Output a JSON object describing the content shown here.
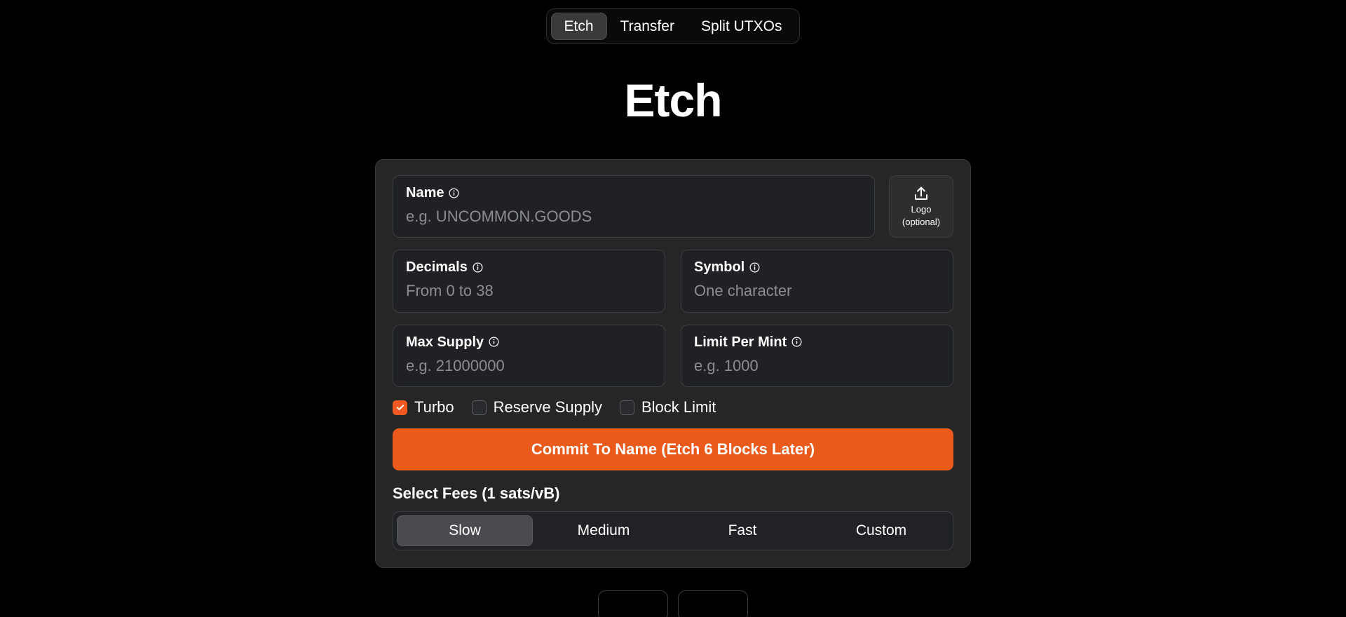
{
  "colors": {
    "page_background": "#000000",
    "card_background": "#262626",
    "field_background": "#202124",
    "accent_orange": "#ea5a1b",
    "checkbox_checked": "#f05a22",
    "selected_pill": "#4a4b4f",
    "text_primary": "#ffffff",
    "text_placeholder": "#8b8d91"
  },
  "tabs": [
    {
      "label": "Etch",
      "selected": true
    },
    {
      "label": "Transfer",
      "selected": false
    },
    {
      "label": "Split UTXOs",
      "selected": false
    }
  ],
  "page": {
    "title": "Etch"
  },
  "form": {
    "name": {
      "label": "Name",
      "placeholder": "e.g. UNCOMMON.GOODS",
      "value": "",
      "info_icon": "info-circle-icon"
    },
    "logo": {
      "line1": "Logo",
      "line2": "(optional)",
      "icon": "upload-icon"
    },
    "decimals": {
      "label": "Decimals",
      "placeholder": "From 0 to 38",
      "value": "",
      "info_icon": "info-circle-icon"
    },
    "symbol": {
      "label": "Symbol",
      "placeholder": "One character",
      "value": "",
      "info_icon": "info-circle-icon"
    },
    "max_supply": {
      "label": "Max Supply",
      "placeholder": "e.g. 21000000",
      "value": "",
      "info_icon": "info-circle-icon"
    },
    "limit_per_mint": {
      "label": "Limit Per Mint",
      "placeholder": "e.g. 1000",
      "value": "",
      "info_icon": "info-circle-icon"
    },
    "checkboxes": [
      {
        "label": "Turbo",
        "checked": true
      },
      {
        "label": "Reserve Supply",
        "checked": false
      },
      {
        "label": "Block Limit",
        "checked": false
      }
    ],
    "commit_button": "Commit To Name (Etch 6 Blocks Later)"
  },
  "fees": {
    "title": "Select Fees (1 sats/vB)",
    "options": [
      {
        "label": "Slow",
        "selected": true
      },
      {
        "label": "Medium",
        "selected": false
      },
      {
        "label": "Fast",
        "selected": false
      },
      {
        "label": "Custom",
        "selected": false
      }
    ]
  }
}
